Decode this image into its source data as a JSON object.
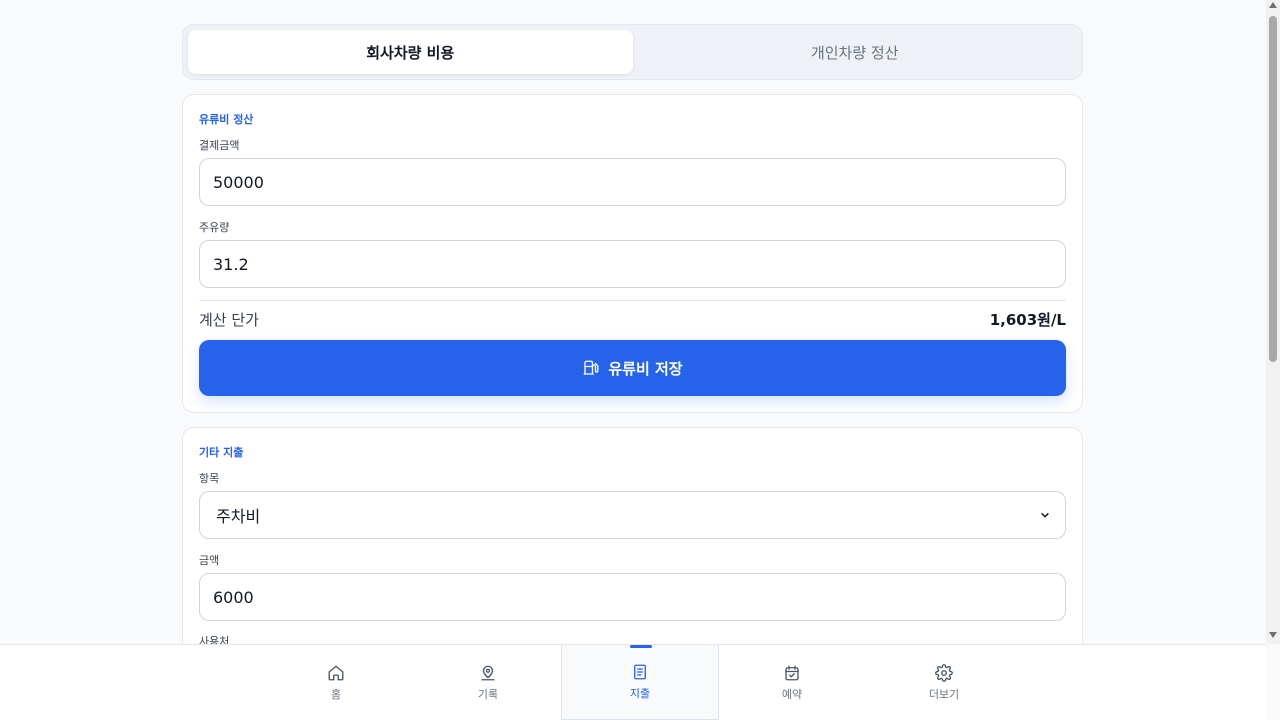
{
  "tabs": [
    {
      "label": "회사차량 비용",
      "active": true
    },
    {
      "label": "개인차량 정산",
      "active": false
    }
  ],
  "fuel": {
    "section_title": "유류비 정산",
    "amount_label": "결제금액",
    "amount_value": "50000",
    "liters_label": "주유량",
    "liters_value": "31.2",
    "calc_label": "계산 단가",
    "calc_value": "1,603원/L",
    "save_label": "유류비 저장",
    "save_icon": "fuel-pump-icon"
  },
  "other": {
    "section_title": "기타 지출",
    "item_label": "항목",
    "item_value": "주차비",
    "amount_label": "금액",
    "amount_value": "6000",
    "place_label": "사용처"
  },
  "nav": [
    {
      "label": "홈",
      "icon": "home-icon"
    },
    {
      "label": "기록",
      "icon": "map-pin-icon"
    },
    {
      "label": "지출",
      "icon": "receipt-icon",
      "active": true
    },
    {
      "label": "예약",
      "icon": "calendar-check-icon"
    },
    {
      "label": "더보기",
      "icon": "gear-icon"
    }
  ],
  "colors": {
    "accent": "#2563eb",
    "background": "#f8fafc"
  }
}
